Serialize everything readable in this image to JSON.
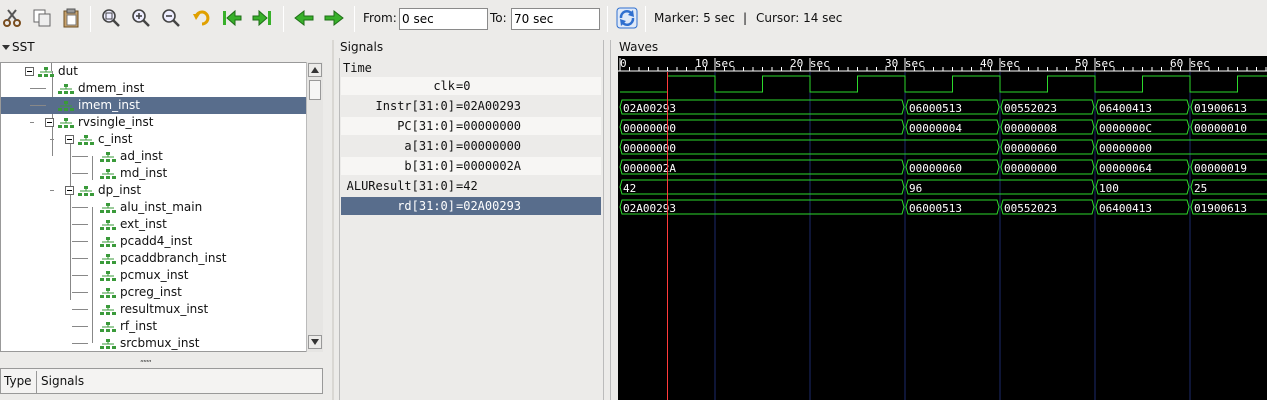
{
  "toolbar": {
    "buttons": [
      "cut-icon",
      "copy-icon",
      "paste-icon",
      "zoom-fit-icon",
      "zoom-in-icon",
      "zoom-out-icon",
      "undo-icon",
      "go-start-icon",
      "go-end-icon",
      "prev-icon",
      "next-icon",
      "reload-icon"
    ],
    "from_label": "From:",
    "from_value": "0 sec",
    "to_label": "To:",
    "to_value": "70 sec",
    "marker_text": "Marker: 5 sec",
    "cursor_text": "Cursor: 14 sec",
    "separator": "|",
    "colors": {
      "arrow_green": "#38b02a",
      "reload_blue": "#2f6fcf"
    }
  },
  "sst": {
    "title": "SST",
    "tree": [
      {
        "label": "dut",
        "depth": 0,
        "expanded": true
      },
      {
        "label": "dmem_inst",
        "depth": 1
      },
      {
        "label": "imem_inst",
        "depth": 1,
        "selected": true
      },
      {
        "label": "rvsingle_inst",
        "depth": 1,
        "expanded": true
      },
      {
        "label": "c_inst",
        "depth": 2,
        "expanded": true
      },
      {
        "label": "ad_inst",
        "depth": 3
      },
      {
        "label": "md_inst",
        "depth": 3
      },
      {
        "label": "dp_inst",
        "depth": 2,
        "expanded": true
      },
      {
        "label": "alu_inst_main",
        "depth": 3
      },
      {
        "label": "ext_inst",
        "depth": 3
      },
      {
        "label": "pcadd4_inst",
        "depth": 3
      },
      {
        "label": "pcaddbranch_inst",
        "depth": 3
      },
      {
        "label": "pcmux_inst",
        "depth": 3
      },
      {
        "label": "pcreg_inst",
        "depth": 3
      },
      {
        "label": "resultmux_inst",
        "depth": 3
      },
      {
        "label": "rf_inst",
        "depth": 3
      },
      {
        "label": "srcbmux_inst",
        "depth": 3
      }
    ],
    "splitter_glyph": ",,,,,,,",
    "type_col": "Type",
    "signals_col": "Signals"
  },
  "signals": {
    "title": "Signals",
    "time_label": "Time",
    "rows": [
      {
        "name": "clk",
        "value": "=0"
      },
      {
        "name": "Instr[31:0]",
        "value": "=02A00293"
      },
      {
        "name": "PC[31:0]",
        "value": "=00000000"
      },
      {
        "name": "a[31:0]",
        "value": "=00000000"
      },
      {
        "name": "b[31:0]",
        "value": "=0000002A"
      },
      {
        "name": "ALUResult[31:0]",
        "value": "=42"
      },
      {
        "name": "rd[31:0]",
        "value": "=02A00293",
        "selected": true
      }
    ]
  },
  "waves": {
    "title": "Waves",
    "time_range": [
      0,
      70
    ],
    "marker_time": 5,
    "ticks": [
      {
        "t": 0,
        "label": "0"
      },
      {
        "t": 10,
        "label": "10 sec"
      },
      {
        "t": 20,
        "label": "20 sec"
      },
      {
        "t": 30,
        "label": "30 sec"
      },
      {
        "t": 40,
        "label": "40 sec"
      },
      {
        "t": 50,
        "label": "50 sec"
      },
      {
        "t": 60,
        "label": "60 sec"
      }
    ],
    "clk_period": 10,
    "buses": [
      {
        "name": "Instr",
        "segments": [
          {
            "t": 0,
            "v": "02A00293"
          },
          {
            "t": 30,
            "v": "06000513"
          },
          {
            "t": 40,
            "v": "00552023"
          },
          {
            "t": 50,
            "v": "06400413"
          },
          {
            "t": 60,
            "v": "01900613"
          }
        ]
      },
      {
        "name": "PC",
        "segments": [
          {
            "t": 0,
            "v": "00000000"
          },
          {
            "t": 30,
            "v": "00000004"
          },
          {
            "t": 40,
            "v": "00000008"
          },
          {
            "t": 50,
            "v": "0000000C"
          },
          {
            "t": 60,
            "v": "00000010"
          }
        ]
      },
      {
        "name": "a",
        "segments": [
          {
            "t": 0,
            "v": "00000000"
          },
          {
            "t": 40,
            "v": "00000060"
          },
          {
            "t": 50,
            "v": "00000000"
          }
        ]
      },
      {
        "name": "b",
        "segments": [
          {
            "t": 0,
            "v": "0000002A"
          },
          {
            "t": 30,
            "v": "00000060"
          },
          {
            "t": 40,
            "v": "00000000"
          },
          {
            "t": 50,
            "v": "00000064"
          },
          {
            "t": 60,
            "v": "00000019"
          }
        ]
      },
      {
        "name": "ALUResult",
        "segments": [
          {
            "t": 0,
            "v": "42"
          },
          {
            "t": 30,
            "v": "96"
          },
          {
            "t": 50,
            "v": "100"
          },
          {
            "t": 60,
            "v": "25"
          }
        ]
      },
      {
        "name": "rd",
        "segments": [
          {
            "t": 0,
            "v": "02A00293"
          },
          {
            "t": 30,
            "v": "06000513"
          },
          {
            "t": 40,
            "v": "00552023"
          },
          {
            "t": 50,
            "v": "06400413"
          },
          {
            "t": 60,
            "v": "01900613"
          }
        ]
      }
    ],
    "colors": {
      "background": "#000000",
      "wave": "#2bd92b",
      "grid": "#1c2a6b",
      "marker": "#ff3a3a",
      "text": "#ffffff"
    }
  }
}
